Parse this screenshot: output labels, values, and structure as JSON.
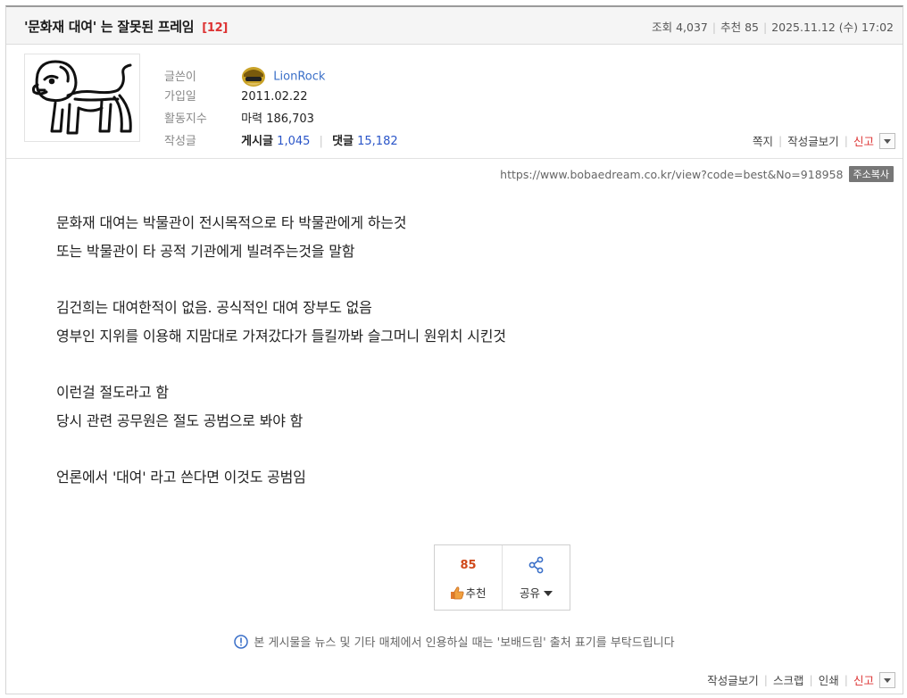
{
  "post": {
    "title": "'문화재 대여' 는 잘못된 프레임",
    "comment_count": "[12]",
    "views": "조회 4,037",
    "recommends": "추천 85",
    "datetime": "2025.11.12 (수) 17:02"
  },
  "author": {
    "labels": {
      "writer": "글쓴이",
      "joined": "가입일",
      "activity": "활동지수",
      "posts": "작성글"
    },
    "nickname": "LionRock",
    "joined": "2011.02.22",
    "activity": "마력 186,703",
    "post_label": "게시글",
    "post_count": "1,045",
    "comment_label": "댓글",
    "comment_count": "15,182"
  },
  "profile_actions": {
    "note": "쪽지",
    "view_posts": "작성글보기",
    "report": "신고"
  },
  "url": {
    "text": "https://www.bobaedream.co.kr/view?code=best&No=918958",
    "copy_label": "주소복사"
  },
  "body_lines": [
    "문화재 대여는 박물관이 전시목적으로 타 박물관에게 하는것",
    "또는 박물관이 타 공적 기관에게 빌려주는것을 말함",
    "",
    "김건희는 대여한적이 없음. 공식적인 대여 장부도 없음",
    "영부인 지위를 이용해 지맘대로 가져갔다가 들킬까봐 슬그머니 원위치 시킨것",
    "",
    "이런걸 절도라고 함",
    "당시 관련 공무원은 절도 공범으로 봐야 함",
    "",
    "언론에서 '대여' 라고 쓴다면 이것도 공범임"
  ],
  "vote": {
    "count": "85",
    "recommend_label": "추천",
    "share_label": "공유"
  },
  "notice": "본 게시물을 뉴스 및 기타 매체에서 인용하실 때는 '보배드림' 출처 표기를 부탁드립니다",
  "bottom_actions": {
    "view_posts": "작성글보기",
    "scrap": "스크랩",
    "print": "인쇄",
    "report": "신고"
  },
  "colors": {
    "accent_red": "#dd3333",
    "link_blue": "#2a55c8",
    "vote_orange": "#d0491b"
  },
  "icons": [
    "lion-avatar-icon",
    "nickname-badge-icon",
    "dropdown-arrow-icon",
    "thumbs-up-icon",
    "share-icon",
    "info-circle-icon"
  ]
}
